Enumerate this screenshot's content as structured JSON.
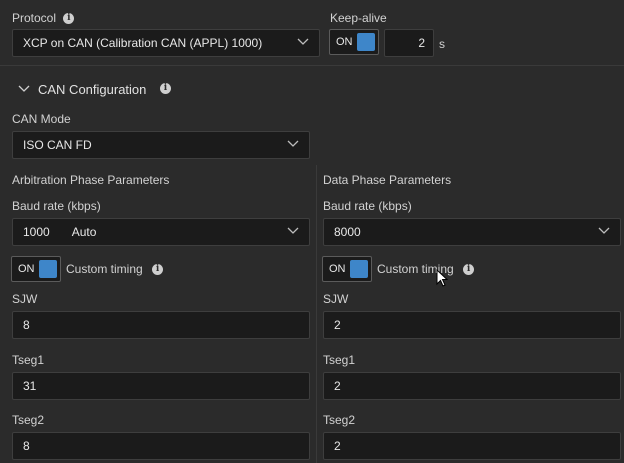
{
  "protocol": {
    "label": "Protocol",
    "value": "XCP on CAN (Calibration CAN (APPL) 1000)"
  },
  "keepalive": {
    "label": "Keep-alive",
    "toggle_label": "ON",
    "value": "2",
    "unit": "s"
  },
  "can_config": {
    "title": "CAN Configuration",
    "mode_label": "CAN Mode",
    "mode_value": "ISO CAN FD"
  },
  "arbitration": {
    "title": "Arbitration Phase Parameters",
    "baud_label": "Baud rate (kbps)",
    "baud_value": "1000",
    "baud_extra": "Auto",
    "toggle_label": "ON",
    "custom_timing_label": "Custom timing",
    "sjw_label": "SJW",
    "sjw_value": "8",
    "tseg1_label": "Tseg1",
    "tseg1_value": "31",
    "tseg2_label": "Tseg2",
    "tseg2_value": "8"
  },
  "data_phase": {
    "title": "Data Phase Parameters",
    "baud_label": "Baud rate (kbps)",
    "baud_value": "8000",
    "toggle_label": "ON",
    "custom_timing_label": "Custom timing",
    "sjw_label": "SJW",
    "sjw_value": "2",
    "tseg1_label": "Tseg1",
    "tseg1_value": "2",
    "tseg2_label": "Tseg2",
    "tseg2_value": "2"
  },
  "colors": {
    "accent": "#3e86c9",
    "background": "#2b2b2b",
    "field": "#1b1b1b"
  }
}
